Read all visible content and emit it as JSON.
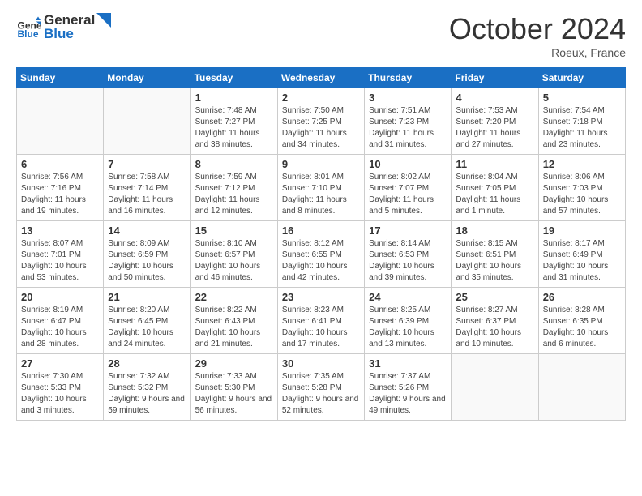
{
  "header": {
    "logo_line1": "General",
    "logo_line2": "Blue",
    "month_title": "October 2024",
    "location": "Roeux, France"
  },
  "weekdays": [
    "Sunday",
    "Monday",
    "Tuesday",
    "Wednesday",
    "Thursday",
    "Friday",
    "Saturday"
  ],
  "weeks": [
    [
      {
        "day": "",
        "sunrise": "",
        "sunset": "",
        "daylight": ""
      },
      {
        "day": "",
        "sunrise": "",
        "sunset": "",
        "daylight": ""
      },
      {
        "day": "1",
        "sunrise": "Sunrise: 7:48 AM",
        "sunset": "Sunset: 7:27 PM",
        "daylight": "Daylight: 11 hours and 38 minutes."
      },
      {
        "day": "2",
        "sunrise": "Sunrise: 7:50 AM",
        "sunset": "Sunset: 7:25 PM",
        "daylight": "Daylight: 11 hours and 34 minutes."
      },
      {
        "day": "3",
        "sunrise": "Sunrise: 7:51 AM",
        "sunset": "Sunset: 7:23 PM",
        "daylight": "Daylight: 11 hours and 31 minutes."
      },
      {
        "day": "4",
        "sunrise": "Sunrise: 7:53 AM",
        "sunset": "Sunset: 7:20 PM",
        "daylight": "Daylight: 11 hours and 27 minutes."
      },
      {
        "day": "5",
        "sunrise": "Sunrise: 7:54 AM",
        "sunset": "Sunset: 7:18 PM",
        "daylight": "Daylight: 11 hours and 23 minutes."
      }
    ],
    [
      {
        "day": "6",
        "sunrise": "Sunrise: 7:56 AM",
        "sunset": "Sunset: 7:16 PM",
        "daylight": "Daylight: 11 hours and 19 minutes."
      },
      {
        "day": "7",
        "sunrise": "Sunrise: 7:58 AM",
        "sunset": "Sunset: 7:14 PM",
        "daylight": "Daylight: 11 hours and 16 minutes."
      },
      {
        "day": "8",
        "sunrise": "Sunrise: 7:59 AM",
        "sunset": "Sunset: 7:12 PM",
        "daylight": "Daylight: 11 hours and 12 minutes."
      },
      {
        "day": "9",
        "sunrise": "Sunrise: 8:01 AM",
        "sunset": "Sunset: 7:10 PM",
        "daylight": "Daylight: 11 hours and 8 minutes."
      },
      {
        "day": "10",
        "sunrise": "Sunrise: 8:02 AM",
        "sunset": "Sunset: 7:07 PM",
        "daylight": "Daylight: 11 hours and 5 minutes."
      },
      {
        "day": "11",
        "sunrise": "Sunrise: 8:04 AM",
        "sunset": "Sunset: 7:05 PM",
        "daylight": "Daylight: 11 hours and 1 minute."
      },
      {
        "day": "12",
        "sunrise": "Sunrise: 8:06 AM",
        "sunset": "Sunset: 7:03 PM",
        "daylight": "Daylight: 10 hours and 57 minutes."
      }
    ],
    [
      {
        "day": "13",
        "sunrise": "Sunrise: 8:07 AM",
        "sunset": "Sunset: 7:01 PM",
        "daylight": "Daylight: 10 hours and 53 minutes."
      },
      {
        "day": "14",
        "sunrise": "Sunrise: 8:09 AM",
        "sunset": "Sunset: 6:59 PM",
        "daylight": "Daylight: 10 hours and 50 minutes."
      },
      {
        "day": "15",
        "sunrise": "Sunrise: 8:10 AM",
        "sunset": "Sunset: 6:57 PM",
        "daylight": "Daylight: 10 hours and 46 minutes."
      },
      {
        "day": "16",
        "sunrise": "Sunrise: 8:12 AM",
        "sunset": "Sunset: 6:55 PM",
        "daylight": "Daylight: 10 hours and 42 minutes."
      },
      {
        "day": "17",
        "sunrise": "Sunrise: 8:14 AM",
        "sunset": "Sunset: 6:53 PM",
        "daylight": "Daylight: 10 hours and 39 minutes."
      },
      {
        "day": "18",
        "sunrise": "Sunrise: 8:15 AM",
        "sunset": "Sunset: 6:51 PM",
        "daylight": "Daylight: 10 hours and 35 minutes."
      },
      {
        "day": "19",
        "sunrise": "Sunrise: 8:17 AM",
        "sunset": "Sunset: 6:49 PM",
        "daylight": "Daylight: 10 hours and 31 minutes."
      }
    ],
    [
      {
        "day": "20",
        "sunrise": "Sunrise: 8:19 AM",
        "sunset": "Sunset: 6:47 PM",
        "daylight": "Daylight: 10 hours and 28 minutes."
      },
      {
        "day": "21",
        "sunrise": "Sunrise: 8:20 AM",
        "sunset": "Sunset: 6:45 PM",
        "daylight": "Daylight: 10 hours and 24 minutes."
      },
      {
        "day": "22",
        "sunrise": "Sunrise: 8:22 AM",
        "sunset": "Sunset: 6:43 PM",
        "daylight": "Daylight: 10 hours and 21 minutes."
      },
      {
        "day": "23",
        "sunrise": "Sunrise: 8:23 AM",
        "sunset": "Sunset: 6:41 PM",
        "daylight": "Daylight: 10 hours and 17 minutes."
      },
      {
        "day": "24",
        "sunrise": "Sunrise: 8:25 AM",
        "sunset": "Sunset: 6:39 PM",
        "daylight": "Daylight: 10 hours and 13 minutes."
      },
      {
        "day": "25",
        "sunrise": "Sunrise: 8:27 AM",
        "sunset": "Sunset: 6:37 PM",
        "daylight": "Daylight: 10 hours and 10 minutes."
      },
      {
        "day": "26",
        "sunrise": "Sunrise: 8:28 AM",
        "sunset": "Sunset: 6:35 PM",
        "daylight": "Daylight: 10 hours and 6 minutes."
      }
    ],
    [
      {
        "day": "27",
        "sunrise": "Sunrise: 7:30 AM",
        "sunset": "Sunset: 5:33 PM",
        "daylight": "Daylight: 10 hours and 3 minutes."
      },
      {
        "day": "28",
        "sunrise": "Sunrise: 7:32 AM",
        "sunset": "Sunset: 5:32 PM",
        "daylight": "Daylight: 9 hours and 59 minutes."
      },
      {
        "day": "29",
        "sunrise": "Sunrise: 7:33 AM",
        "sunset": "Sunset: 5:30 PM",
        "daylight": "Daylight: 9 hours and 56 minutes."
      },
      {
        "day": "30",
        "sunrise": "Sunrise: 7:35 AM",
        "sunset": "Sunset: 5:28 PM",
        "daylight": "Daylight: 9 hours and 52 minutes."
      },
      {
        "day": "31",
        "sunrise": "Sunrise: 7:37 AM",
        "sunset": "Sunset: 5:26 PM",
        "daylight": "Daylight: 9 hours and 49 minutes."
      },
      {
        "day": "",
        "sunrise": "",
        "sunset": "",
        "daylight": ""
      },
      {
        "day": "",
        "sunrise": "",
        "sunset": "",
        "daylight": ""
      }
    ]
  ]
}
